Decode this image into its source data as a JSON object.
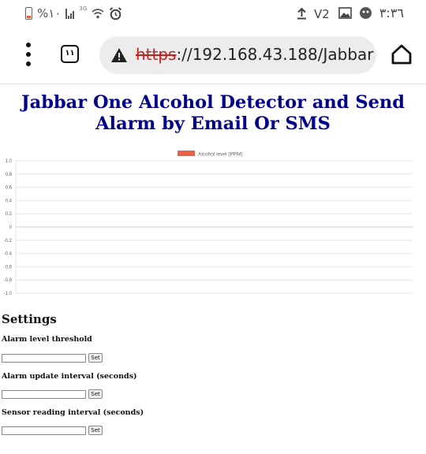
{
  "status_bar": {
    "battery_percent": "%١٠",
    "network_type": "3G",
    "clock": "٣:٣٦",
    "icons": [
      "battery-icon",
      "signal-icon",
      "wifi-icon",
      "alarm-icon",
      "upload-icon",
      "volte-icon",
      "gallery-icon",
      "app-notification-icon"
    ]
  },
  "browser": {
    "tab_count": "١١",
    "url_scheme": "https",
    "url_rest": "://192.168.43.188/Jabbar",
    "insecure_icon": "warning-triangle-icon",
    "home_icon": "home-icon"
  },
  "page": {
    "title": "Jabbar One Alcohol Detector and Send Alarm by Email Or SMS"
  },
  "chart_data": {
    "type": "line",
    "legend": [
      {
        "name": "Alcohol level (PPM)",
        "color": "#e8624a"
      }
    ],
    "legend_position": "top",
    "series": [
      {
        "name": "Alcohol level (PPM)",
        "values": []
      }
    ],
    "ylim": [
      -1.0,
      1.0
    ],
    "yticks": [
      "1.0",
      "0.8",
      "0.6",
      "0.4",
      "0.2",
      "0",
      "-0.2",
      "-0.4",
      "-0.6",
      "-0.8",
      "-1.0"
    ],
    "grid": true
  },
  "settings": {
    "heading": "Settings",
    "fields": [
      {
        "label": "Alarm level threshold",
        "value": "",
        "button": "Set"
      },
      {
        "label": "Alarm update interval (seconds)",
        "value": "",
        "button": "Set"
      },
      {
        "label": "Sensor reading interval (seconds)",
        "value": "",
        "button": "Set"
      }
    ]
  }
}
